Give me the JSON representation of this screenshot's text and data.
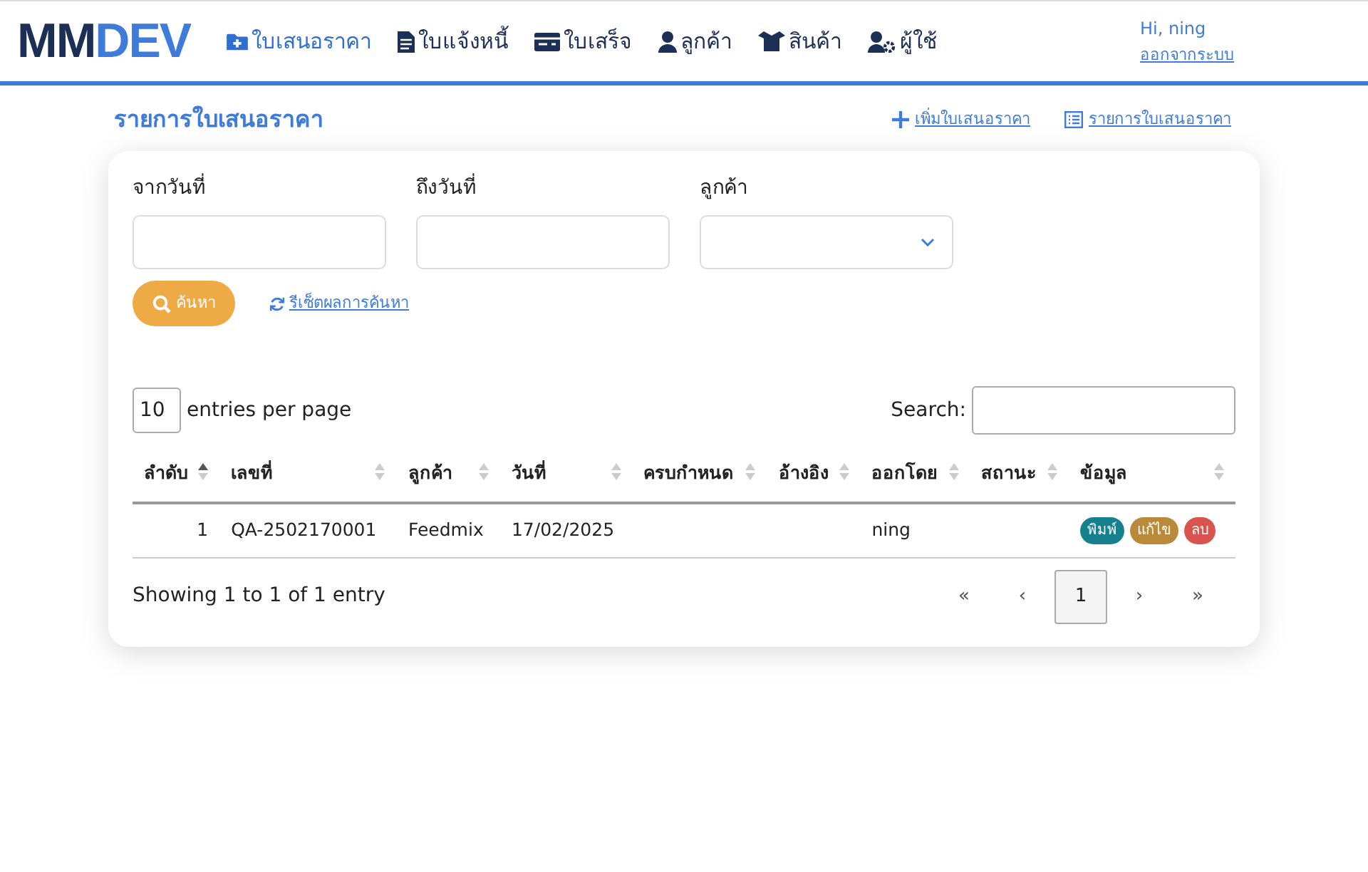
{
  "logo": {
    "part_1": "MM",
    "part_2": "DEV"
  },
  "nav": [
    {
      "label": "ใบเสนอราคา",
      "selected": true
    },
    {
      "label": "ใบแจ้งหนี้",
      "selected": false
    },
    {
      "label": "ใบเสร็จ",
      "selected": false
    },
    {
      "label": "ลูกค้า",
      "selected": false
    },
    {
      "label": "สินค้า",
      "selected": false
    },
    {
      "label": "ผู้ใช้",
      "selected": false
    }
  ],
  "user": {
    "greeting": "Hi, ning",
    "logout": "ออกจากระบบ"
  },
  "page_title": "รายการใบเสนอราคา",
  "actions": [
    {
      "label": "เพิ่มใบเสนอราคา"
    },
    {
      "label": "รายการใบเสนอราคา"
    }
  ],
  "filters": [
    {
      "label": "จากวันที่",
      "kind": "text"
    },
    {
      "label": "ถึงวันที่",
      "kind": "text"
    },
    {
      "label": "ลูกค้า",
      "kind": "select"
    }
  ],
  "search_button": "ค้นหา",
  "reset_link": "รีเซ็ตผลการค้นหา",
  "table": {
    "page_size": "10",
    "page_size_label": "entries per page",
    "search_label": "Search:",
    "columns": [
      {
        "label": "ลำดับ",
        "sorted": true
      },
      {
        "label": "เลขที่",
        "sorted": false
      },
      {
        "label": "ลูกค้า",
        "sorted": false
      },
      {
        "label": "วันที่",
        "sorted": false
      },
      {
        "label": "ครบกำหนด",
        "sorted": false
      },
      {
        "label": "อ้างอิง",
        "sorted": false
      },
      {
        "label": "ออกโดย",
        "sorted": false
      },
      {
        "label": "สถานะ",
        "sorted": false
      },
      {
        "label": "ข้อมูล",
        "sorted": false
      }
    ],
    "rows": [
      {
        "cells": [
          "1",
          "QA-2502170001",
          "Feedmix",
          "17/02/2025",
          "",
          "",
          "ning",
          ""
        ],
        "actions": [
          {
            "label": "พิมพ์",
            "color": "#17808f"
          },
          {
            "label": "แก้ไข",
            "color": "#b88a3a"
          },
          {
            "label": "ลบ",
            "color": "#d9534f"
          }
        ]
      }
    ],
    "info": "Showing 1 to 1 of 1 entry",
    "pagination": [
      {
        "label": "«",
        "selected": false
      },
      {
        "label": "‹",
        "selected": false
      },
      {
        "label": "1",
        "selected": true
      },
      {
        "label": "›",
        "selected": false
      },
      {
        "label": "»",
        "selected": false
      }
    ]
  }
}
